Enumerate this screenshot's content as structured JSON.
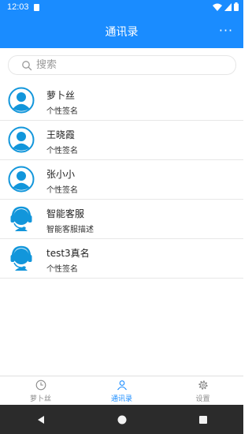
{
  "status": {
    "time": "12:03"
  },
  "app_bar": {
    "title": "通讯录",
    "more_label": "···"
  },
  "search": {
    "placeholder": "搜索",
    "value": ""
  },
  "contacts": [
    {
      "name": "萝卜丝",
      "subtitle": "个性签名",
      "avatar": "person-icon"
    },
    {
      "name": "王晓霞",
      "subtitle": "个性签名",
      "avatar": "person-icon"
    },
    {
      "name": "张小小",
      "subtitle": "个性签名",
      "avatar": "person-icon"
    },
    {
      "name": "智能客服",
      "subtitle": "智能客服描述",
      "avatar": "headset-icon"
    },
    {
      "name": "test3真名",
      "subtitle": "个性签名",
      "avatar": "headset-icon"
    }
  ],
  "bottom_nav": [
    {
      "label": "萝卜丝",
      "icon": "clock-icon",
      "active": false
    },
    {
      "label": "通讯录",
      "icon": "contacts-icon",
      "active": true
    },
    {
      "label": "设置",
      "icon": "gear-icon",
      "active": false
    }
  ],
  "colors": {
    "primary": "#1a8cff",
    "avatar": "#1296db",
    "text": "#222222",
    "inactive": "#8c8c8c"
  }
}
